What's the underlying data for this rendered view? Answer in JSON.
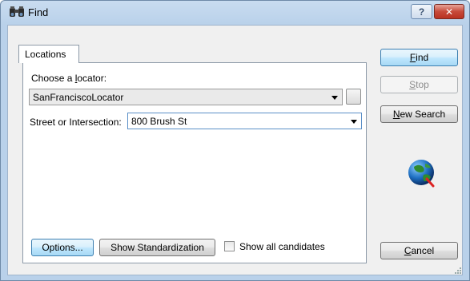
{
  "window": {
    "title": "Find",
    "help_glyph": "?",
    "close_glyph": "✕",
    "title_icon": "binoculars-icon"
  },
  "tabs": [
    {
      "label": "Locations",
      "selected": true
    }
  ],
  "locator": {
    "label_pre": "Choose a ",
    "label_mnemonic": "l",
    "label_post": "ocator:",
    "value": "SanFranciscoLocator"
  },
  "street": {
    "label": "Street or Intersection:",
    "value": "800 Brush St"
  },
  "bottom": {
    "options_label": "Options...",
    "standardization_label": "Show Standardization",
    "show_all_label": "Show all candidates",
    "show_all_checked": false
  },
  "side_buttons": {
    "find_mnemonic": "F",
    "find_rest": "ind",
    "stop_mnemonic": "S",
    "stop_rest": "top",
    "new_search_mnemonic": "N",
    "new_search_rest": "ew Search",
    "cancel_mnemonic": "C",
    "cancel_rest": "ancel"
  },
  "icons": {
    "globe": "globe-icon",
    "grip": "resize-grip-icon"
  }
}
